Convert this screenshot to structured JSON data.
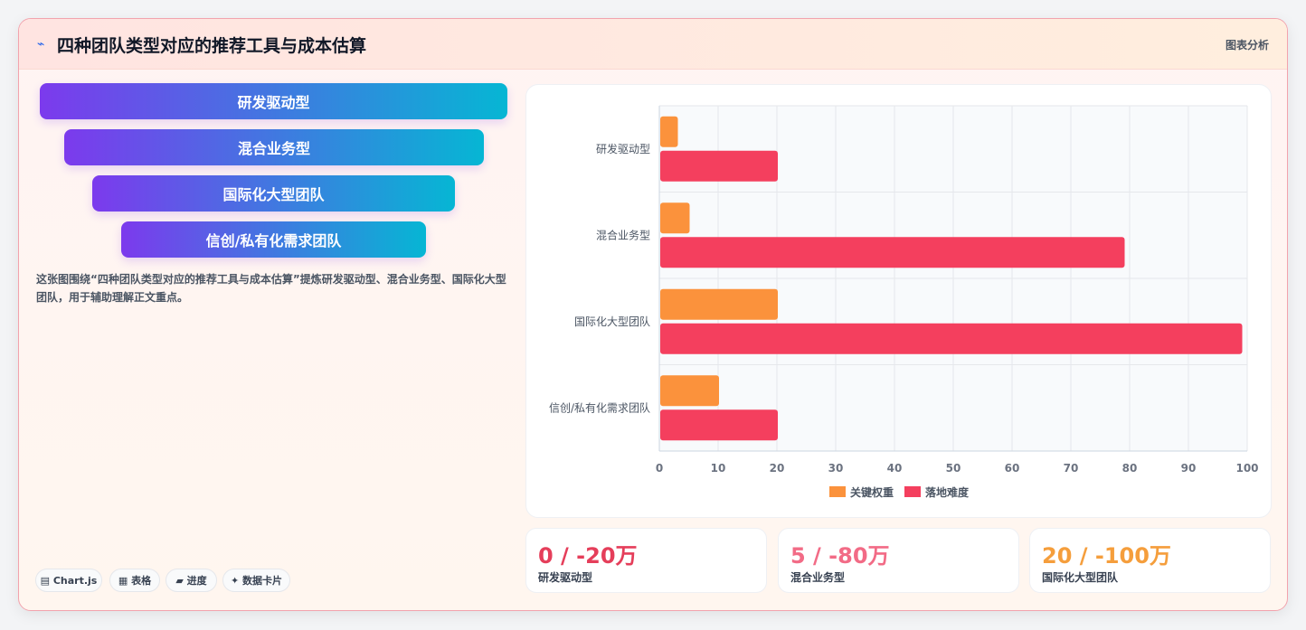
{
  "header": {
    "icon": "lightning-icon",
    "title": "四种团队类型对应的推荐工具与成本估算",
    "link": "图表分析"
  },
  "funnel": {
    "items": [
      "研发驱动型",
      "混合业务型",
      "国际化大型团队",
      "信创/私有化需求团队"
    ],
    "gradient": [
      "#7c3aed",
      "#06b6d4"
    ]
  },
  "description": "这张图围绕“四种团队类型对应的推荐工具与成本估算”提炼研发驱动型、混合业务型、国际化大型团队，用于辅助理解正文重点。",
  "tags": [
    "▤ Chart.js",
    "▦ 表格",
    "▰ 进度",
    "✦ 数据卡片"
  ],
  "stats": [
    {
      "value": "0 / -20万",
      "label": "研发驱动型",
      "color": "#e53e5a"
    },
    {
      "value": "5 / -80万",
      "label": "混合业务型",
      "color": "#f26b86"
    },
    {
      "value": "20 / -100万",
      "label": "国际化大型团队",
      "color": "#f59e3c"
    }
  ],
  "chart_data": {
    "type": "bar",
    "orientation": "horizontal",
    "categories": [
      "研发驱动型",
      "混合业务型",
      "国际化大型团队",
      "信创/私有化需求团队"
    ],
    "series": [
      {
        "name": "关键权重",
        "values": [
          3,
          5,
          20,
          10
        ],
        "color": "#fb923c"
      },
      {
        "name": "落地难度",
        "values": [
          20,
          79,
          99,
          20
        ],
        "color": "#f43f5e"
      }
    ],
    "xlim": [
      0,
      100
    ],
    "xticks": [
      0,
      10,
      20,
      30,
      40,
      50,
      60,
      70,
      80,
      90,
      100
    ],
    "grid": true,
    "legend_position": "bottom"
  }
}
